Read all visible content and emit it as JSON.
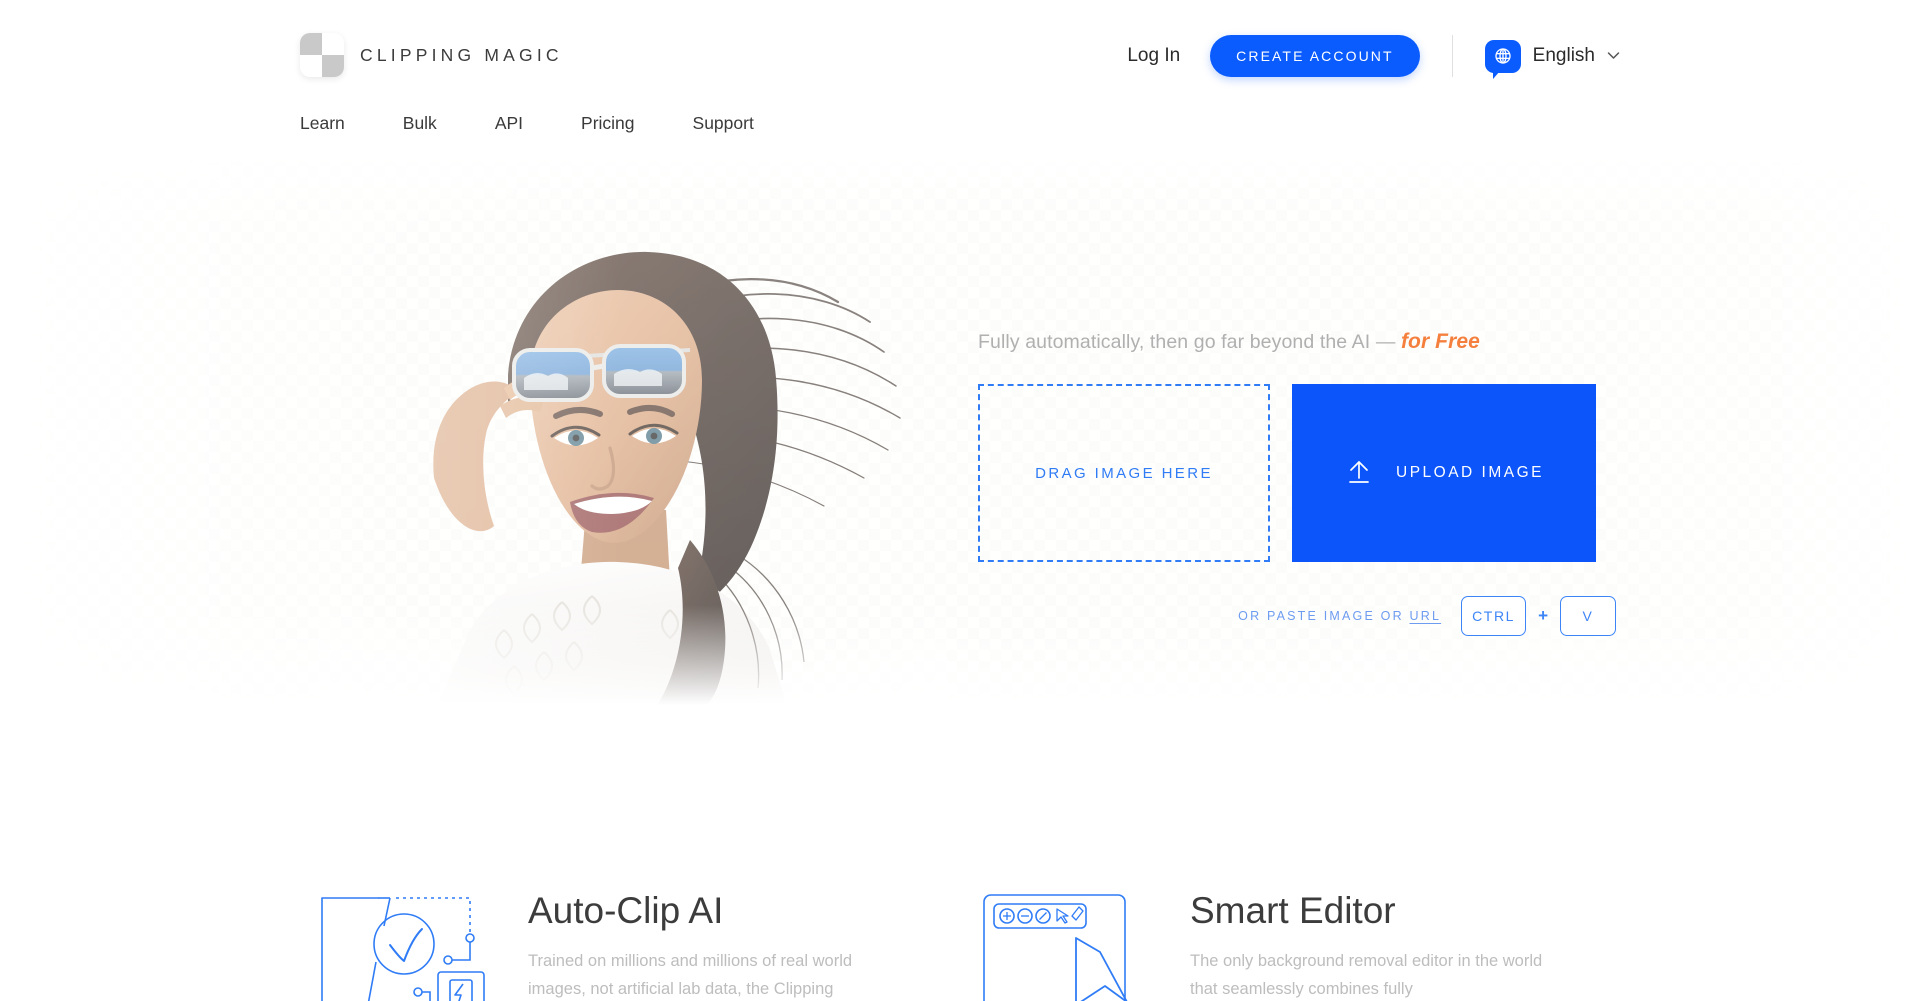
{
  "header": {
    "brand_name": "CLIPPING MAGIC",
    "logo_icon": "checkerboard-logo-icon",
    "login_label": "Log In",
    "cta_label": "CREATE ACCOUNT",
    "language": {
      "icon": "globe-icon",
      "label": "English",
      "chevron": "chevron-down-icon"
    },
    "nav": [
      {
        "label": "Learn"
      },
      {
        "label": "Bulk"
      },
      {
        "label": "API"
      },
      {
        "label": "Pricing"
      },
      {
        "label": "Support"
      }
    ]
  },
  "hero": {
    "photo_alt": "smiling woman with sunglasses on forehead and windblown hair",
    "tagline_main": "Fully automatically, then go far beyond the AI — ",
    "tagline_accent": "for Free",
    "dropzone_label": "DRAG IMAGE HERE",
    "upload_button_label": "UPLOAD IMAGE",
    "upload_icon": "upload-arrow-icon",
    "paste_prefix": "OR PASTE IMAGE OR ",
    "paste_url": "URL",
    "key_ctrl": "CTRL",
    "key_plus": "+",
    "key_v": "V"
  },
  "features": [
    {
      "art": "auto-clip-ai-illustration",
      "title": "Auto-Clip AI",
      "text": "Trained on millions and millions of real world images, not artificial lab data, the Clipping"
    },
    {
      "art": "smart-editor-illustration",
      "title": "Smart Editor",
      "text": "The only background removal editor in the world that seamlessly combines fully"
    }
  ],
  "colors": {
    "brand_blue": "#0b5cff",
    "upload_blue": "#0b55fa",
    "dash_blue": "#2f7cf6",
    "accent_orange": "#f5803e",
    "text_dark": "#3c3c3c",
    "text_muted": "#bdbdbd"
  }
}
